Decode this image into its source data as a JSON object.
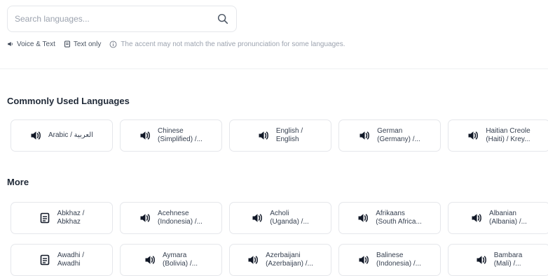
{
  "search": {
    "placeholder": "Search languages..."
  },
  "legend": {
    "voice_text": "Voice & Text",
    "text_only": "Text only",
    "note": "The accent may not match the native pronunciation for some languages."
  },
  "sections": {
    "common_title": "Commonly Used Languages",
    "more_title": "More"
  },
  "common_languages": [
    {
      "label": "Arabic / العربية",
      "icon": "speaker-icon"
    },
    {
      "label": "Chinese\n(Simplified) /...",
      "icon": "speaker-icon"
    },
    {
      "label": "English /\nEnglish",
      "icon": "speaker-icon"
    },
    {
      "label": "German\n(Germany) /...",
      "icon": "speaker-icon"
    },
    {
      "label": "Haitian Creole\n(Haiti) / Krey...",
      "icon": "speaker-icon"
    }
  ],
  "more_languages_row1": [
    {
      "label": "Abkhaz /\nAbkhaz",
      "icon": "document-icon"
    },
    {
      "label": "Acehnese\n(Indonesia) /...",
      "icon": "speaker-icon"
    },
    {
      "label": "Acholi\n(Uganda) /...",
      "icon": "speaker-icon"
    },
    {
      "label": "Afrikaans\n(South Africa...",
      "icon": "speaker-icon"
    },
    {
      "label": "Albanian\n(Albania) /...",
      "icon": "speaker-icon"
    }
  ],
  "more_languages_row2": [
    {
      "label": "Awadhi /\nAwadhi",
      "icon": "document-icon"
    },
    {
      "label": "Aymara\n(Bolivia) /...",
      "icon": "speaker-icon"
    },
    {
      "label": "Azerbaijani\n(Azerbaijan) /...",
      "icon": "speaker-icon"
    },
    {
      "label": "Balinese\n(Indonesia) /...",
      "icon": "speaker-icon"
    },
    {
      "label": "Bambara\n(Mali) /...",
      "icon": "speaker-icon"
    }
  ]
}
